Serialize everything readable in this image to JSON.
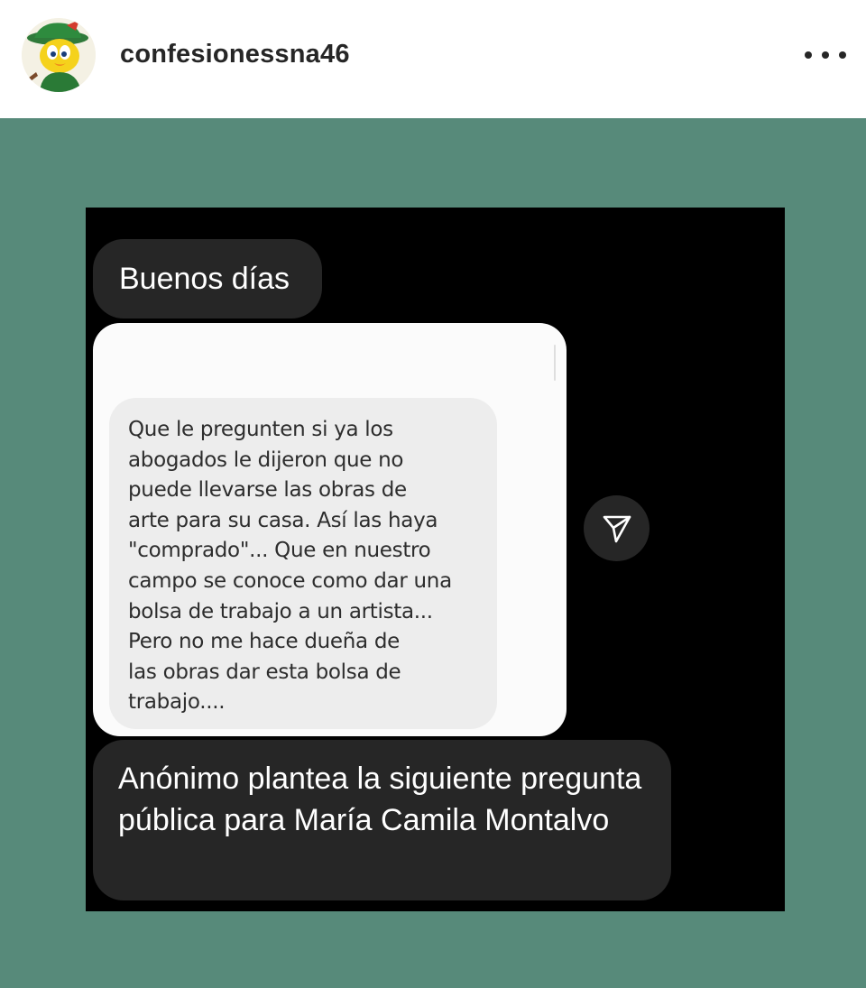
{
  "header": {
    "username": "confesionessna46",
    "avatar_icon": "cartoon-bird-avatar-icon",
    "more_icon": "more-options-icon"
  },
  "post": {
    "background_color": "#578a7a",
    "messages": {
      "greeting": "Buenos días",
      "shared_message": "Que le pregunten si ya los\nabogados le dijeron que no\npuede llevarse las obras de\narte para su casa. Así las haya\n\"comprado\"... Que en nuestro\ncampo se conoce como dar una\nbolsa de trabajo a un artista...\nPero no me hace dueña de\nlas obras dar esta bolsa de\ntrabajo....",
      "question": "Anónimo plantea la siguiente pregunta pública para María Camila Montalvo"
    },
    "send_icon": "send-arrow-icon"
  }
}
